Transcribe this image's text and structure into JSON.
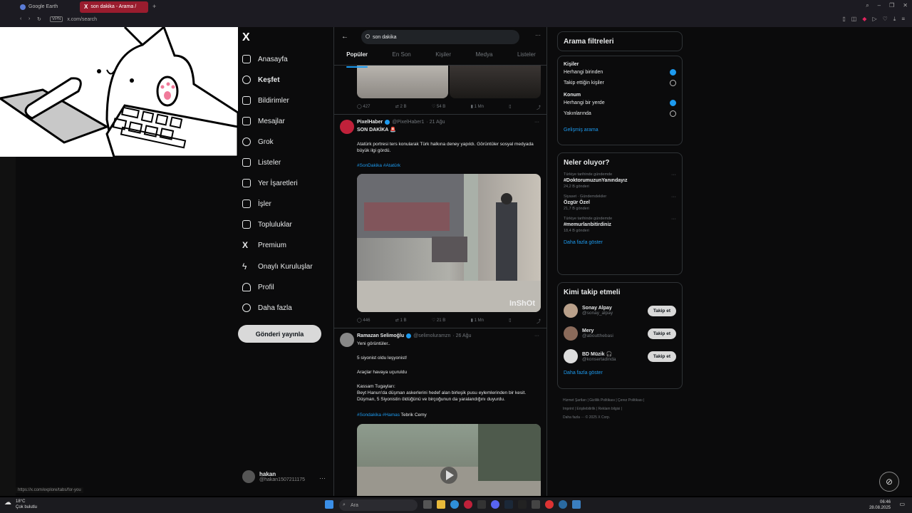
{
  "browser": {
    "tabs": [
      {
        "label": "Google Earth"
      },
      {
        "label": "son dakika - Arama /"
      }
    ],
    "new_tab": "+",
    "vpn": "VPN",
    "url": "x.com/search"
  },
  "nav": {
    "logo": "X",
    "items": [
      {
        "label": "Anasayfa",
        "icon": "home-icon"
      },
      {
        "label": "Keşfet",
        "icon": "search-icon"
      },
      {
        "label": "Bildirimler",
        "icon": "bell-icon"
      },
      {
        "label": "Mesajlar",
        "icon": "mail-icon"
      },
      {
        "label": "Grok",
        "icon": "grok-icon"
      },
      {
        "label": "Listeler",
        "icon": "list-icon"
      },
      {
        "label": "Yer İşaretleri",
        "icon": "bookmark-icon"
      },
      {
        "label": "İşler",
        "icon": "briefcase-icon"
      },
      {
        "label": "Topluluklar",
        "icon": "people-icon"
      },
      {
        "label": "Premium",
        "icon": "x-icon"
      },
      {
        "label": "Onaylı Kuruluşlar",
        "icon": "lightning-icon"
      },
      {
        "label": "Profil",
        "icon": "person-icon"
      },
      {
        "label": "Daha fazla",
        "icon": "more-circle-icon"
      }
    ],
    "post_button": "Gönderi yayınla",
    "account_name": "hakan",
    "account_handle": "@hakan1507211175",
    "account_more": "···"
  },
  "search": {
    "query": "son dakika",
    "more": "···",
    "tabs": [
      "Popüler",
      "En Son",
      "Kişiler",
      "Medya",
      "Listeler"
    ]
  },
  "tweets": [
    {
      "actions": {
        "reply": "427",
        "repost": "2 B",
        "like": "54 B",
        "views": "1 Mn"
      }
    },
    {
      "name": "PixelHaber",
      "handle": "@PixelHaber1",
      "date": "· 21 Ağu",
      "title": "SON DAKİKA 🚨",
      "text": "Atatürk portresi ters konularak Türk halkına deney yapıldı. Görüntüler sosyal medyada büyük ilgi gördü.",
      "tags": "#SonDakika #Atatürk",
      "watermark": "InShOt",
      "actions": {
        "reply": "446",
        "repost": "1 B",
        "like": "21 B",
        "views": "1 Mn"
      }
    },
    {
      "name": "Ramazan Selimoğlu",
      "handle": "@selimoluramzn",
      "date": "· 26 Ağu",
      "lines": [
        "Yeni görüntüler..",
        "5 siyonist oldu leşyonist!",
        "Araçlar havaya uçuruldu",
        "Kassam Tugayları:",
        "Beyt Hanun'da düşman askerlerini hedef alan birleşik pusu eylemlerinden bir kesit. Düşman, 5 Siyonistin öldüğünü ve birçoğunun da yaralandığını duyurdu."
      ],
      "tags": "#Sondakika #Hamas",
      "tag_suffix": " Tebrik Cemy"
    }
  ],
  "filters": {
    "title": "Arama filtreleri",
    "people_label": "Kişiler",
    "people": [
      {
        "label": "Herhangi birinden",
        "selected": true
      },
      {
        "label": "Takip ettiğin kişiler",
        "selected": false
      }
    ],
    "location_label": "Konum",
    "locations": [
      {
        "label": "Herhangi bir yerde",
        "selected": true
      },
      {
        "label": "Yakınlarında",
        "selected": false
      }
    ],
    "advanced": "Gelişmiş arama"
  },
  "trends": {
    "title": "Neler oluyor?",
    "items": [
      {
        "context": "Türkiye tarihinde gündemde",
        "name": "#DoktorumuzunYanındayız",
        "count": "24,2 B gönderi"
      },
      {
        "context": "Siyaset · Gündemdekiler",
        "name": "Özgür Özel",
        "count": "21,7 B gönderi"
      },
      {
        "context": "Türkiye tarihinde gündemde",
        "name": "#memurlarıbitirdiniz",
        "count": "18,4 B gönderi"
      }
    ],
    "more": "Daha fazla göster",
    "item_more": "···"
  },
  "who_to_follow": {
    "title": "Kimi takip etmeli",
    "items": [
      {
        "name": "Sonay Alpay",
        "handle": "@sonay_alpay",
        "button": "Takip et"
      },
      {
        "name": "Mery",
        "handle": "@aboutthebasi",
        "button": "Takip et"
      },
      {
        "name": "BD Müzik 🎧",
        "handle": "@konsertadinda",
        "button": "Takip et"
      }
    ],
    "more": "Daha fazla göster"
  },
  "footer": {
    "line1": "Hizmet Şartları  |  Gizlilik Politikası  |  Çerez Politikası  |",
    "line2": "Imprint  |  Erişilebilirlik  |  Reklam bilgisi  |",
    "line3": "Daha fazla ···    © 2025 X Corp."
  },
  "status_url": "https://x.com/explore/tabs/for-you",
  "taskbar": {
    "temp": "18°C",
    "weather": "Çok bulutlu",
    "search": "Ara",
    "time": "06:46",
    "date": "28.08.2025"
  },
  "colors": {
    "accent": "#1d9bf0",
    "tab_active": "#9a1c2e",
    "opera_red": "#c0213a"
  }
}
